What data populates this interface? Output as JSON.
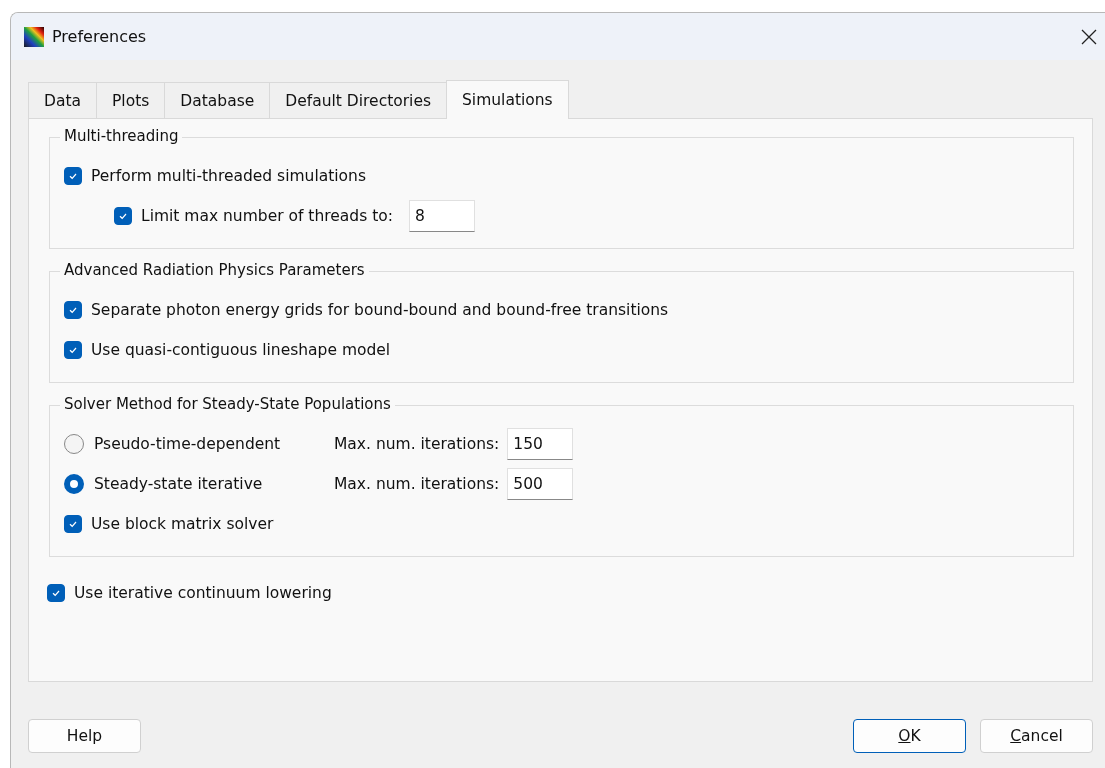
{
  "window": {
    "title": "Preferences"
  },
  "tabs": [
    {
      "label": "Data",
      "selected": false
    },
    {
      "label": "Plots",
      "selected": false
    },
    {
      "label": "Database",
      "selected": false
    },
    {
      "label": "Default Directories",
      "selected": false
    },
    {
      "label": "Simulations",
      "selected": true
    }
  ],
  "groups": [
    {
      "title": "Multi-threading",
      "items": [
        {
          "kind": "checkbox",
          "label": "Perform multi-threaded simulations",
          "checked": true,
          "children": [
            {
              "kind": "checkbox",
              "label": "Limit max number of threads to:",
              "checked": true,
              "value": "8"
            }
          ]
        }
      ]
    },
    {
      "title": "Advanced Radiation Physics Parameters",
      "items": [
        {
          "kind": "checkbox",
          "label": "Separate photon energy grids for bound-bound and bound-free transitions",
          "checked": true
        },
        {
          "kind": "checkbox",
          "label": "Use quasi-contiguous lineshape model",
          "checked": true
        }
      ]
    },
    {
      "title": "Solver Method for Steady-State Populations",
      "items": [
        {
          "kind": "radio",
          "label": "Pseudo-time-dependent",
          "selected": false,
          "field_label": "Max. num. iterations:",
          "value": "150"
        },
        {
          "kind": "radio",
          "label": "Steady-state iterative",
          "selected": true,
          "field_label": "Max. num. iterations:",
          "value": "500"
        },
        {
          "kind": "checkbox",
          "label": "Use block matrix solver",
          "checked": true
        }
      ]
    }
  ],
  "items": [
    {
      "kind": "checkbox",
      "label": "Use iterative continuum lowering",
      "checked": true
    }
  ],
  "buttons": [
    {
      "label": "Help",
      "default": false,
      "underline_first": false
    },
    {
      "label": "OK",
      "default": true,
      "underline_first": true
    },
    {
      "label": "Cancel",
      "default": false,
      "underline_first": true
    }
  ]
}
